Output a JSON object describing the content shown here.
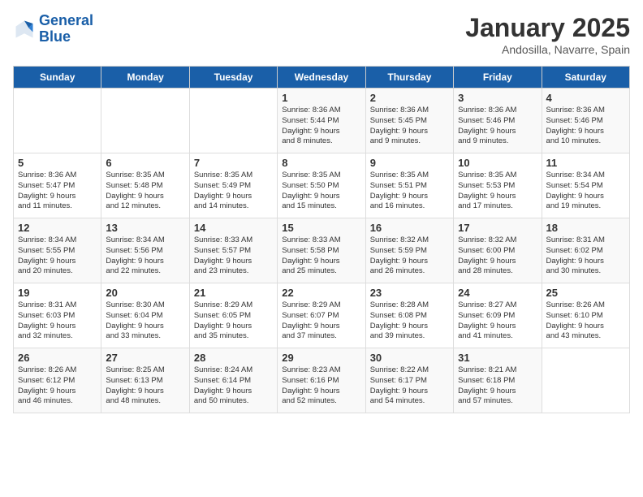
{
  "logo": {
    "line1": "General",
    "line2": "Blue"
  },
  "title": "January 2025",
  "location": "Andosilla, Navarre, Spain",
  "weekdays": [
    "Sunday",
    "Monday",
    "Tuesday",
    "Wednesday",
    "Thursday",
    "Friday",
    "Saturday"
  ],
  "weeks": [
    [
      {
        "day": "",
        "text": ""
      },
      {
        "day": "",
        "text": ""
      },
      {
        "day": "",
        "text": ""
      },
      {
        "day": "1",
        "text": "Sunrise: 8:36 AM\nSunset: 5:44 PM\nDaylight: 9 hours\nand 8 minutes."
      },
      {
        "day": "2",
        "text": "Sunrise: 8:36 AM\nSunset: 5:45 PM\nDaylight: 9 hours\nand 9 minutes."
      },
      {
        "day": "3",
        "text": "Sunrise: 8:36 AM\nSunset: 5:46 PM\nDaylight: 9 hours\nand 9 minutes."
      },
      {
        "day": "4",
        "text": "Sunrise: 8:36 AM\nSunset: 5:46 PM\nDaylight: 9 hours\nand 10 minutes."
      }
    ],
    [
      {
        "day": "5",
        "text": "Sunrise: 8:36 AM\nSunset: 5:47 PM\nDaylight: 9 hours\nand 11 minutes."
      },
      {
        "day": "6",
        "text": "Sunrise: 8:35 AM\nSunset: 5:48 PM\nDaylight: 9 hours\nand 12 minutes."
      },
      {
        "day": "7",
        "text": "Sunrise: 8:35 AM\nSunset: 5:49 PM\nDaylight: 9 hours\nand 14 minutes."
      },
      {
        "day": "8",
        "text": "Sunrise: 8:35 AM\nSunset: 5:50 PM\nDaylight: 9 hours\nand 15 minutes."
      },
      {
        "day": "9",
        "text": "Sunrise: 8:35 AM\nSunset: 5:51 PM\nDaylight: 9 hours\nand 16 minutes."
      },
      {
        "day": "10",
        "text": "Sunrise: 8:35 AM\nSunset: 5:53 PM\nDaylight: 9 hours\nand 17 minutes."
      },
      {
        "day": "11",
        "text": "Sunrise: 8:34 AM\nSunset: 5:54 PM\nDaylight: 9 hours\nand 19 minutes."
      }
    ],
    [
      {
        "day": "12",
        "text": "Sunrise: 8:34 AM\nSunset: 5:55 PM\nDaylight: 9 hours\nand 20 minutes."
      },
      {
        "day": "13",
        "text": "Sunrise: 8:34 AM\nSunset: 5:56 PM\nDaylight: 9 hours\nand 22 minutes."
      },
      {
        "day": "14",
        "text": "Sunrise: 8:33 AM\nSunset: 5:57 PM\nDaylight: 9 hours\nand 23 minutes."
      },
      {
        "day": "15",
        "text": "Sunrise: 8:33 AM\nSunset: 5:58 PM\nDaylight: 9 hours\nand 25 minutes."
      },
      {
        "day": "16",
        "text": "Sunrise: 8:32 AM\nSunset: 5:59 PM\nDaylight: 9 hours\nand 26 minutes."
      },
      {
        "day": "17",
        "text": "Sunrise: 8:32 AM\nSunset: 6:00 PM\nDaylight: 9 hours\nand 28 minutes."
      },
      {
        "day": "18",
        "text": "Sunrise: 8:31 AM\nSunset: 6:02 PM\nDaylight: 9 hours\nand 30 minutes."
      }
    ],
    [
      {
        "day": "19",
        "text": "Sunrise: 8:31 AM\nSunset: 6:03 PM\nDaylight: 9 hours\nand 32 minutes."
      },
      {
        "day": "20",
        "text": "Sunrise: 8:30 AM\nSunset: 6:04 PM\nDaylight: 9 hours\nand 33 minutes."
      },
      {
        "day": "21",
        "text": "Sunrise: 8:29 AM\nSunset: 6:05 PM\nDaylight: 9 hours\nand 35 minutes."
      },
      {
        "day": "22",
        "text": "Sunrise: 8:29 AM\nSunset: 6:07 PM\nDaylight: 9 hours\nand 37 minutes."
      },
      {
        "day": "23",
        "text": "Sunrise: 8:28 AM\nSunset: 6:08 PM\nDaylight: 9 hours\nand 39 minutes."
      },
      {
        "day": "24",
        "text": "Sunrise: 8:27 AM\nSunset: 6:09 PM\nDaylight: 9 hours\nand 41 minutes."
      },
      {
        "day": "25",
        "text": "Sunrise: 8:26 AM\nSunset: 6:10 PM\nDaylight: 9 hours\nand 43 minutes."
      }
    ],
    [
      {
        "day": "26",
        "text": "Sunrise: 8:26 AM\nSunset: 6:12 PM\nDaylight: 9 hours\nand 46 minutes."
      },
      {
        "day": "27",
        "text": "Sunrise: 8:25 AM\nSunset: 6:13 PM\nDaylight: 9 hours\nand 48 minutes."
      },
      {
        "day": "28",
        "text": "Sunrise: 8:24 AM\nSunset: 6:14 PM\nDaylight: 9 hours\nand 50 minutes."
      },
      {
        "day": "29",
        "text": "Sunrise: 8:23 AM\nSunset: 6:16 PM\nDaylight: 9 hours\nand 52 minutes."
      },
      {
        "day": "30",
        "text": "Sunrise: 8:22 AM\nSunset: 6:17 PM\nDaylight: 9 hours\nand 54 minutes."
      },
      {
        "day": "31",
        "text": "Sunrise: 8:21 AM\nSunset: 6:18 PM\nDaylight: 9 hours\nand 57 minutes."
      },
      {
        "day": "",
        "text": ""
      }
    ]
  ]
}
